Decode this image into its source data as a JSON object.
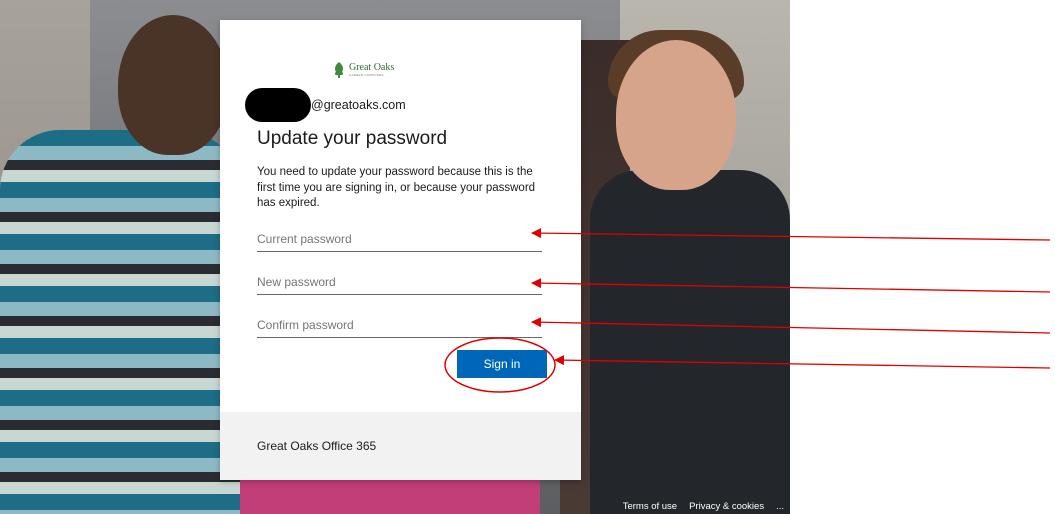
{
  "brand": {
    "logo_text": "Great Oaks",
    "logo_sub": "CAREER CAMPUSES"
  },
  "identity": {
    "email_suffix": "@greatoaks.com"
  },
  "dialog": {
    "title": "Update your password",
    "description": "You need to update your password because this is the first time you are signing in, or because your password has expired.",
    "fields": {
      "current_password": {
        "placeholder": "Current password",
        "value": ""
      },
      "new_password": {
        "placeholder": "New password",
        "value": ""
      },
      "confirm_password": {
        "placeholder": "Confirm password",
        "value": ""
      }
    },
    "signin_label": "Sign in",
    "footer_text": "Great Oaks Office 365"
  },
  "page_footer": {
    "terms": "Terms of use",
    "privacy": "Privacy & cookies",
    "more": "..."
  },
  "colors": {
    "accent": "#0067b8",
    "annotation": "#e00000"
  },
  "icons": {
    "logo": "oak-leaf-icon",
    "more": "ellipsis-icon"
  }
}
